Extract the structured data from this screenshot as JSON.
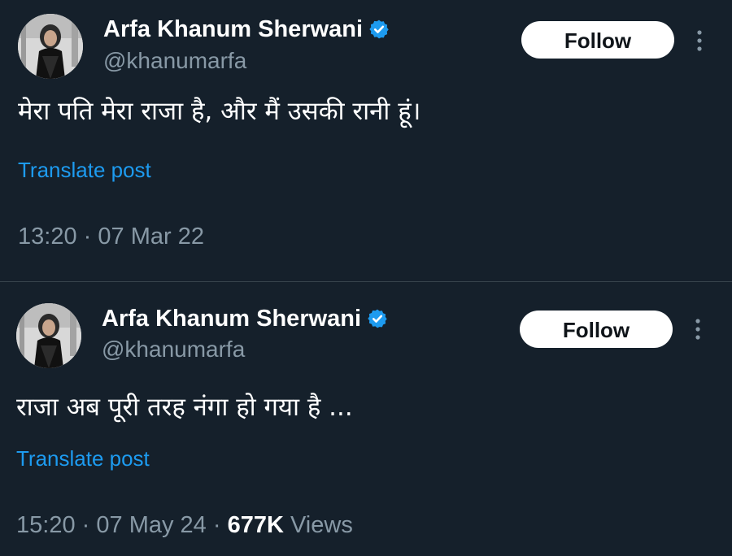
{
  "colors": {
    "background": "#15202b",
    "divider": "#38444d",
    "primary_text": "#ffffff",
    "secondary_text": "#8899a6",
    "link": "#1d9bf0",
    "verified_badge": "#1d9bf0",
    "follow_button_bg": "#ffffff",
    "follow_button_text": "#0f1419"
  },
  "icons": {
    "verified": "verified-badge-icon",
    "more": "more-vertical-icon",
    "avatar": "profile-photo"
  },
  "tweets": [
    {
      "author": {
        "display_name": "Arfa Khanum Sherwani",
        "handle": "@khanumarfa",
        "verified": true
      },
      "follow_label": "Follow",
      "text": "मेरा पति मेरा राजा है, और मैं उसकी रानी हूं।",
      "translate_label": "Translate post",
      "time": "13:20",
      "separator": "·",
      "date": "07 Mar 22"
    },
    {
      "author": {
        "display_name": "Arfa Khanum Sherwani",
        "handle": "@khanumarfa",
        "verified": true
      },
      "follow_label": "Follow",
      "text": "राजा अब पूरी तरह नंगा हो गया है ...",
      "translate_label": "Translate post",
      "time": "15:20",
      "separator": "·",
      "date": "07 May 24",
      "views_count": "677K",
      "views_label": "Views"
    }
  ]
}
